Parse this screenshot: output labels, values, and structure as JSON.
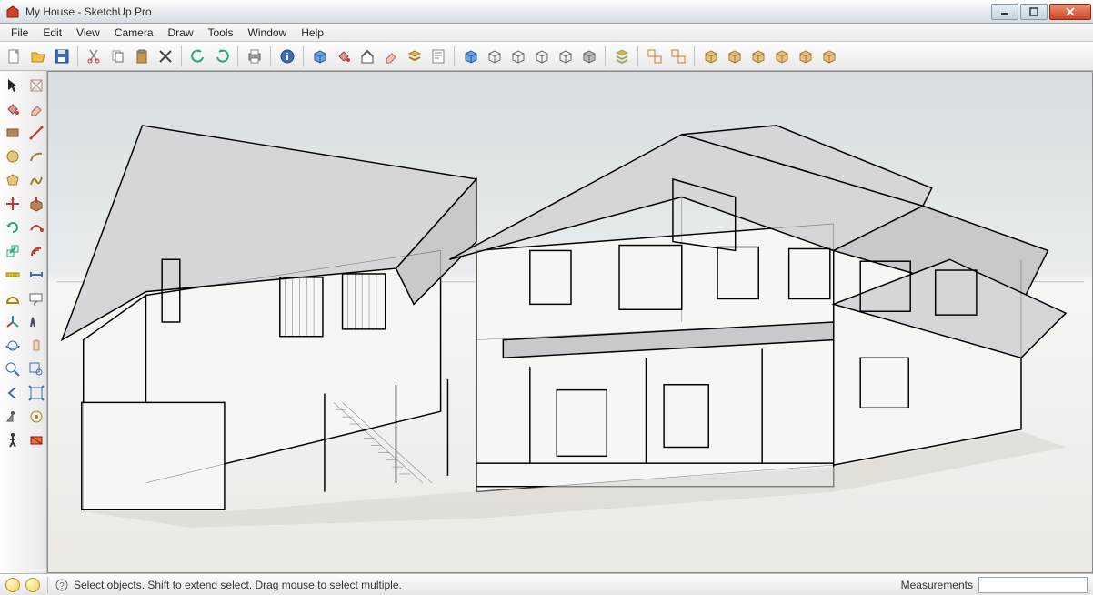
{
  "titlebar": {
    "title": "My House - SketchUp Pro"
  },
  "menu": {
    "items": [
      "File",
      "Edit",
      "View",
      "Camera",
      "Draw",
      "Tools",
      "Window",
      "Help"
    ]
  },
  "topToolbar": [
    "new-file-icon",
    "open-file-icon",
    "save-icon",
    "|",
    "cut-icon",
    "copy-icon",
    "paste-icon",
    "delete-icon",
    "|",
    "undo-icon",
    "redo-icon",
    "|",
    "print-icon",
    "|",
    "info-icon",
    "|",
    "component-icon",
    "paint-bucket-icon",
    "home-icon",
    "eraser-icon",
    "layers-icon",
    "notes-icon",
    "|",
    "box-blue-icon",
    "box-wire-icon",
    "box-wire2-icon",
    "box-shaded-icon",
    "box-tex-icon",
    "box-solid-icon",
    "|",
    "stack-icon",
    "|",
    "group-icon",
    "ungroup-icon",
    "|",
    "send-back-icon",
    "explode-icon",
    "outer-shell-icon",
    "intersect-icon",
    "subtract-icon",
    "trim-icon"
  ],
  "leftToolbar": [
    "select-icon",
    "make-component-icon",
    "paint-bucket-tool-icon",
    "eraser-tool-icon",
    "rectangle-icon",
    "line-icon",
    "circle-icon",
    "arc-icon",
    "polygon-icon",
    "freehand-icon",
    "move-icon",
    "push-pull-icon",
    "rotate-icon",
    "follow-me-icon",
    "scale-icon",
    "offset-icon",
    "tape-measure-icon",
    "dimension-icon",
    "protractor-icon",
    "text-label-icon",
    "axes-icon",
    "3d-text-icon",
    "orbit-icon",
    "pan-icon",
    "zoom-icon",
    "zoom-window-icon",
    "previous-icon",
    "zoom-extents-icon",
    "position-camera-icon",
    "look-around-icon",
    "walk-icon",
    "section-plane-icon"
  ],
  "status": {
    "hint": "Select objects. Shift to extend select. Drag mouse to select multiple.",
    "measurementsLabel": "Measurements"
  }
}
